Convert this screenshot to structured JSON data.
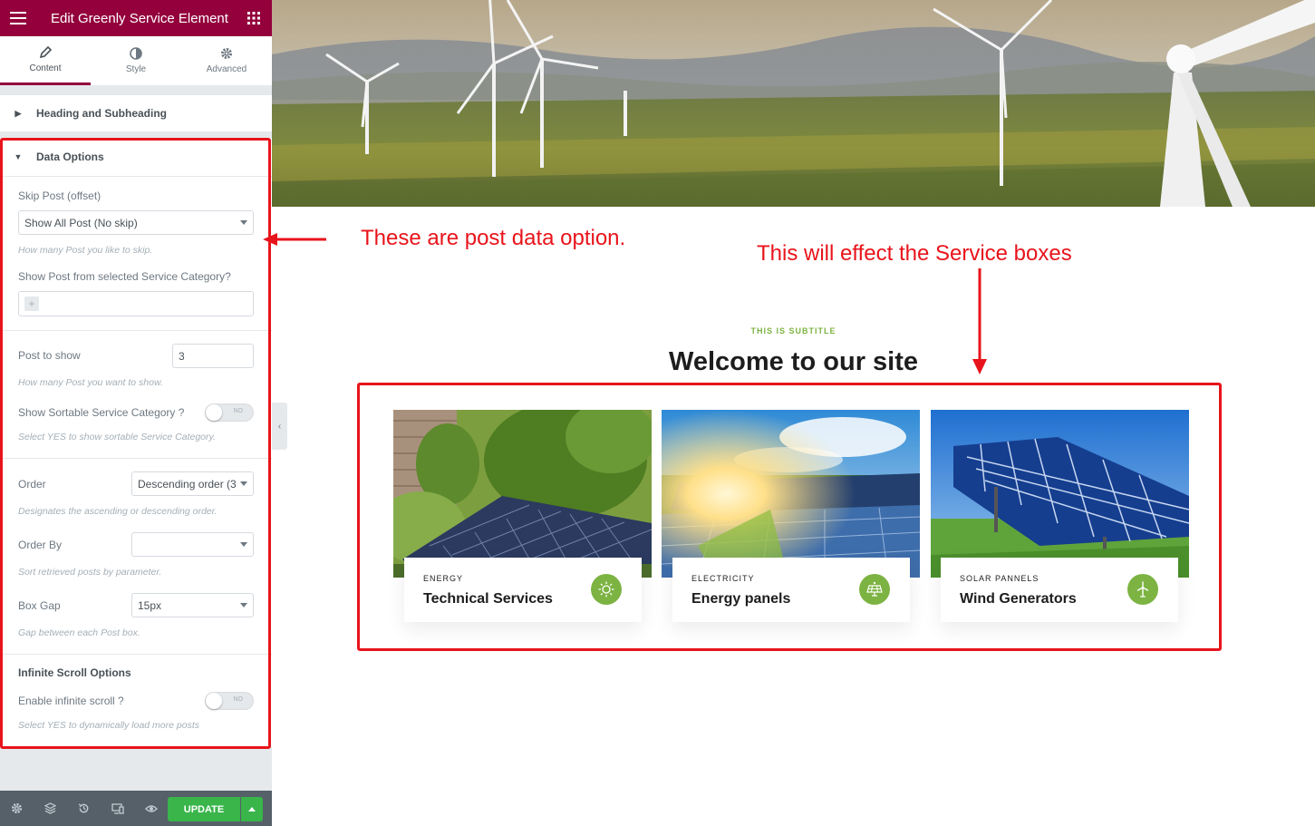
{
  "editor": {
    "title": "Edit Greenly Service Element",
    "tabs": [
      {
        "label": "Content",
        "icon": "pencil-icon"
      },
      {
        "label": "Style",
        "icon": "contrast-icon"
      },
      {
        "label": "Advanced",
        "icon": "gear-icon"
      }
    ],
    "sections": {
      "heading": "Heading and Subheading",
      "data_options": "Data Options",
      "infinite_scroll": "Infinite Scroll Options"
    },
    "controls": {
      "skip_post_label": "Skip Post (offset)",
      "skip_post_value": "Show All Post (No skip)",
      "skip_post_desc": "How many Post you like to skip.",
      "category_label": "Show Post from selected Service Category?",
      "post_to_show_label": "Post to show",
      "post_to_show_value": "3",
      "post_to_show_desc": "How many Post you want to show.",
      "sortable_label": "Show Sortable Service Category ?",
      "sortable_toggle": "NO",
      "sortable_desc": "Select YES to show sortable Service Category.",
      "order_label": "Order",
      "order_value": "Descending order (3",
      "order_desc": "Designates the ascending or descending order.",
      "order_by_label": "Order By",
      "order_by_value": "",
      "order_by_desc": "Sort retrieved posts by parameter.",
      "box_gap_label": "Box Gap",
      "box_gap_value": "15px",
      "box_gap_desc": "Gap between each Post box.",
      "infinite_label": "Enable infinite scroll ?",
      "infinite_toggle": "NO",
      "infinite_desc": "Select YES to dynamically load more posts"
    },
    "footer": {
      "update_label": "UPDATE"
    }
  },
  "annotations": {
    "left": "These are post data option.",
    "right": "This will effect the Service boxes"
  },
  "preview": {
    "subtitle": "THIS IS SUBTITLE",
    "heading": "Welcome to our site",
    "cards": [
      {
        "category": "ENERGY",
        "title": "Technical Services",
        "icon": "sun-icon"
      },
      {
        "category": "ELECTRICITY",
        "title": "Energy panels",
        "icon": "solar-panel-icon"
      },
      {
        "category": "SOLAR PANNELS",
        "title": "Wind Generators",
        "icon": "wind-turbine-icon"
      }
    ]
  },
  "colors": {
    "brand": "#93003c",
    "accent_green": "#7cb342",
    "update_green": "#39b54a",
    "annotation_red": "#e8141b"
  }
}
